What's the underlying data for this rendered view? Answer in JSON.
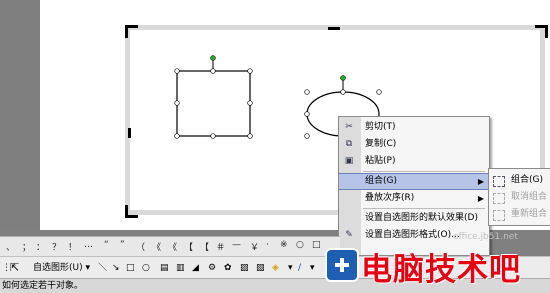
{
  "context_menu": {
    "items": [
      {
        "label": "剪切(T)",
        "icon": "scissors-icon"
      },
      {
        "label": "复制(C)",
        "icon": "copy-icon"
      },
      {
        "label": "粘贴(P)",
        "icon": "paste-icon"
      },
      {
        "label": "组合(G)",
        "icon": "",
        "submenu": true,
        "highlighted": true
      },
      {
        "label": "叠放次序(R)",
        "icon": "",
        "submenu": true
      },
      {
        "label": "设置自选图形的默认效果(D)",
        "icon": ""
      },
      {
        "label": "设置自选图形格式(O)...",
        "icon": "format-icon"
      }
    ]
  },
  "submenu": {
    "items": [
      {
        "label": "组合(G)",
        "enabled": true
      },
      {
        "label": "取消组合",
        "enabled": false
      },
      {
        "label": "重新组合",
        "enabled": false
      }
    ]
  },
  "drawing_toolbar": {
    "autoshapes_label": "自选图形(U) ▾"
  },
  "status_bar": {
    "text": "如何选定若干对象。"
  },
  "watermark": {
    "brand": "电脑技术吧",
    "url": "office.jb51.net"
  },
  "colors": {
    "menu_highlight": "#b6c4e8",
    "brand_red": "#e60012",
    "handle_green": "#22aa22"
  }
}
